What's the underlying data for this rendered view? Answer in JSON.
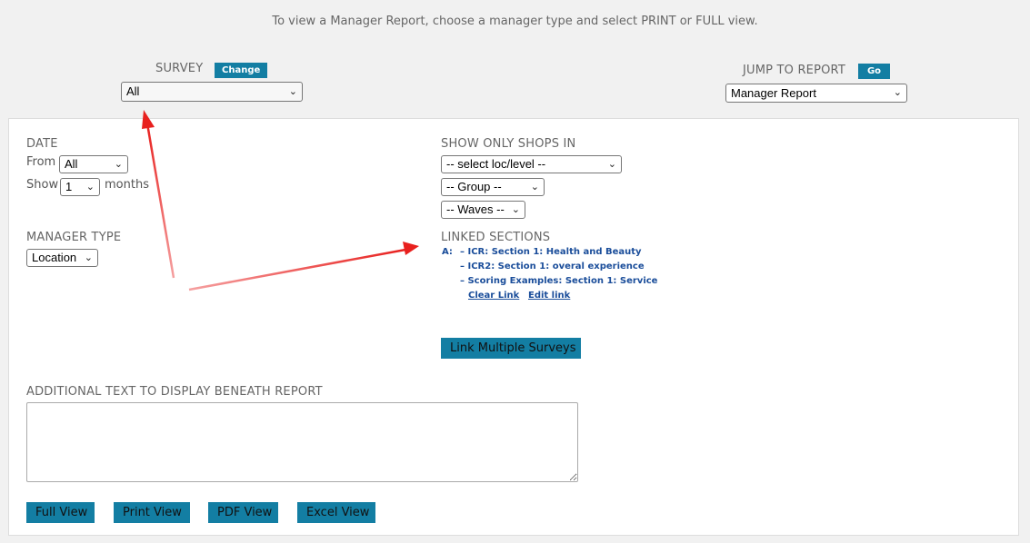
{
  "intro_text": "To view a Manager Report, choose a manager type and select PRINT or FULL view.",
  "survey": {
    "label": "SURVEY",
    "change_label": "Change",
    "selected": "All"
  },
  "jump": {
    "label": "JUMP TO REPORT",
    "go_label": "Go",
    "selected": "Manager Report"
  },
  "date": {
    "label": "DATE",
    "from_label": "From",
    "from_selected": "All",
    "show_label": "Show",
    "show_selected": "1",
    "months_label": "months"
  },
  "manager_type": {
    "label": "MANAGER TYPE",
    "selected": "Location"
  },
  "shops": {
    "label": "SHOW ONLY SHOPS IN",
    "loc_selected": "-- select loc/level --",
    "group_selected": "-- Group --",
    "waves_selected": "-- Waves --"
  },
  "linked": {
    "label": "LINKED SECTIONS",
    "prefix": "A:",
    "items": [
      "– ICR: Section 1: Health and Beauty",
      "– ICR2: Section 1: overal experience",
      "– Scoring Examples: Section 1: Service"
    ],
    "clear_link": "Clear Link",
    "edit_link": "Edit link",
    "link_multiple": "Link Multiple Surveys"
  },
  "additional_text": {
    "label": "ADDITIONAL TEXT TO DISPLAY BENEATH REPORT",
    "value": ""
  },
  "views": {
    "full": "Full View",
    "print": "Print View",
    "pdf": "PDF View",
    "excel": "Excel View"
  },
  "colors": {
    "button_bg": "#137ea3",
    "link": "#1a4d9a",
    "arrow": "#e8201e",
    "page_bg": "#f1f1f1"
  }
}
